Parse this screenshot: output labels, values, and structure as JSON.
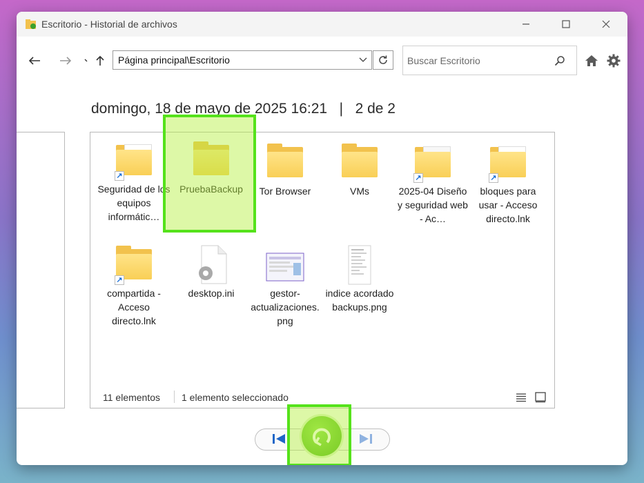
{
  "window": {
    "title": "Escritorio - Historial de archivos"
  },
  "toolbar": {
    "address": "Página principal\\Escritorio",
    "search_placeholder": "Buscar Escritorio"
  },
  "header": {
    "date": "domingo, 18 de mayo de 2025 16:21",
    "separator": "|",
    "position": "2 de 2"
  },
  "items": [
    {
      "label": "Seguridad de los equipos informátic…",
      "icon": "folder-shortcut-icon"
    },
    {
      "label": "PruebaBackup",
      "icon": "folder-icon",
      "selected": true
    },
    {
      "label": "Tor Browser",
      "icon": "folder-icon"
    },
    {
      "label": "VMs",
      "icon": "folder-icon"
    },
    {
      "label": "2025-04 Diseño y seguridad web - Ac…",
      "icon": "folder-shortcut-icon"
    },
    {
      "label": "bloques para usar - Acceso directo.lnk",
      "icon": "folder-shortcut-icon"
    },
    {
      "label": "compartida - Acceso directo.lnk",
      "icon": "folder-shortcut-icon"
    },
    {
      "label": "desktop.ini",
      "icon": "settings-file-icon"
    },
    {
      "label": "gestor-actualizaciones.png",
      "icon": "image-file-icon"
    },
    {
      "label": "indice acordado backups.png",
      "icon": "image-file-icon"
    }
  ],
  "status": {
    "count": "11 elementos",
    "selection": "1 elemento seleccionado"
  },
  "colors": {
    "highlight": "#55e21b",
    "restore_button": "#4cae16",
    "folder": "#f9cf56"
  }
}
